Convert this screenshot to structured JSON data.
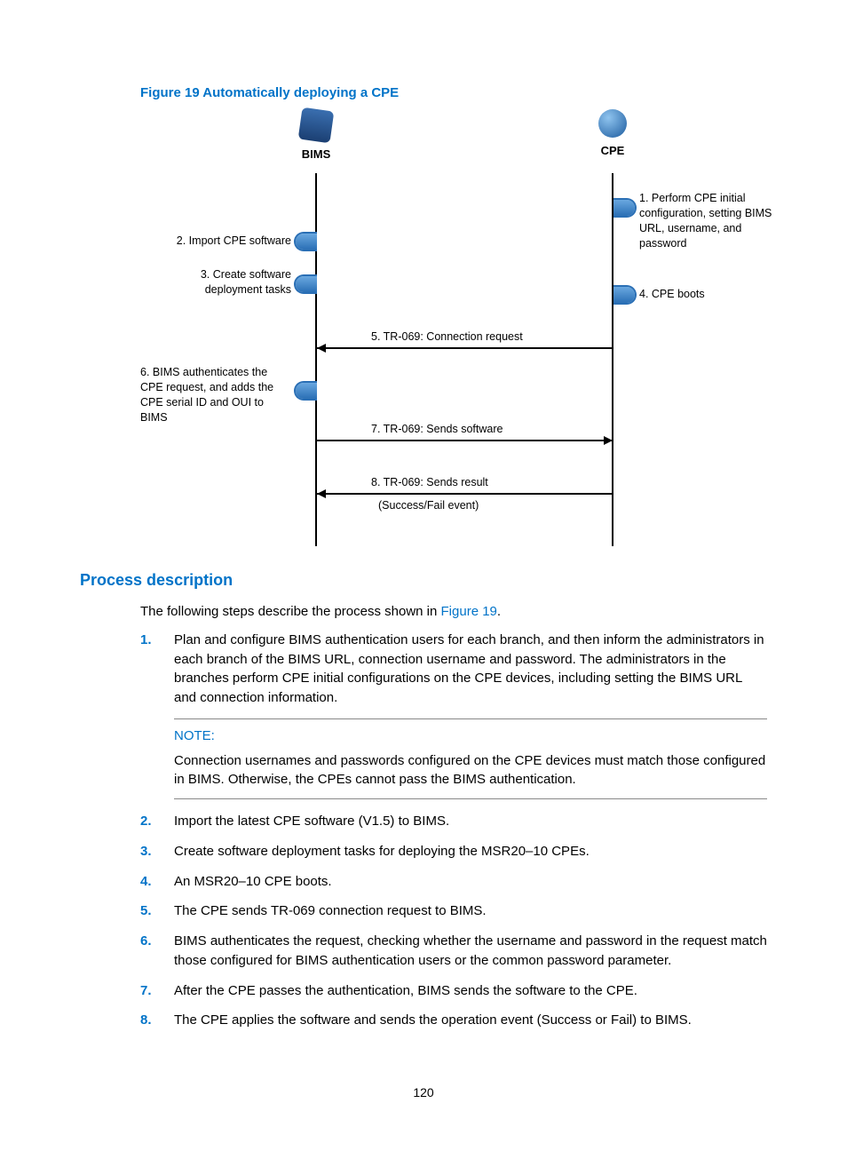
{
  "figure": {
    "caption": "Figure 19 Automatically deploying a CPE",
    "bims_label": "BIMS",
    "cpe_label": "CPE",
    "step1": "1. Perform CPE initial configuration, setting BIMS URL, username, and password",
    "step2": "2. Import CPE software",
    "step3": "3. Create software deployment tasks",
    "step4": "4. CPE boots",
    "step5": "5. TR-069:  Connection request",
    "step6": "6. BIMS authenticates the CPE request, and adds the CPE serial ID and OUI to BIMS",
    "step7": "7. TR-069: Sends software",
    "step8a": "8. TR-069: Sends result",
    "step8b": "(Success/Fail event)"
  },
  "process": {
    "title": "Process description",
    "intro_prefix": "The following steps describe the process shown in ",
    "intro_link": "Figure 19",
    "intro_suffix": ".",
    "note_label": "NOTE:",
    "note_text": "Connection usernames and passwords configured on the CPE devices must match those configured in BIMS. Otherwise, the CPEs cannot pass the BIMS authentication.",
    "steps": {
      "s1_num": "1.",
      "s1": "Plan and configure BIMS authentication users for each branch, and then inform the administrators in each branch of the BIMS URL, connection username and password. The administrators in the branches perform CPE initial configurations on the CPE devices, including setting the BIMS URL and connection information.",
      "s2_num": "2.",
      "s2": "Import the latest CPE software (V1.5) to BIMS.",
      "s3_num": "3.",
      "s3": "Create software deployment tasks for deploying the MSR20–10 CPEs.",
      "s4_num": "4.",
      "s4": "An MSR20–10 CPE boots.",
      "s5_num": "5.",
      "s5": "The CPE sends TR-069 connection request to BIMS.",
      "s6_num": "6.",
      "s6": "BIMS authenticates the request, checking whether the username and password in the request match those configured for BIMS authentication users or the common password parameter.",
      "s7_num": "7.",
      "s7": "After the CPE passes the authentication, BIMS sends the software to the CPE.",
      "s8_num": "8.",
      "s8": "The CPE applies the software and sends the operation event (Success or Fail) to BIMS."
    }
  },
  "page_number": "120"
}
